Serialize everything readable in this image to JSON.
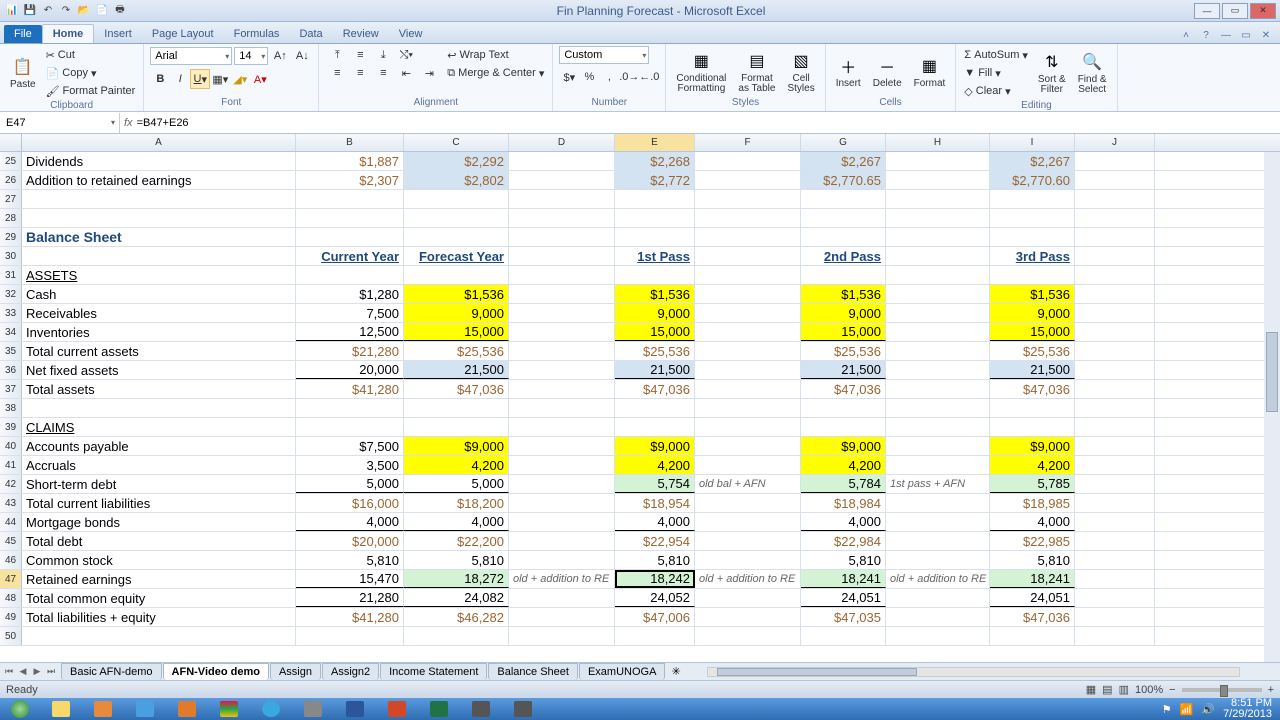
{
  "app": {
    "title": "Fin Planning Forecast - Microsoft Excel"
  },
  "qat": {
    "save": "💾",
    "undo": "↶",
    "redo": "↷",
    "open": "📂",
    "new": "📄"
  },
  "tabs": {
    "file": "File",
    "home": "Home",
    "insert": "Insert",
    "pageLayout": "Page Layout",
    "formulas": "Formulas",
    "data": "Data",
    "review": "Review",
    "view": "View"
  },
  "ribbon": {
    "clipboard": {
      "label": "Clipboard",
      "paste": "Paste",
      "cut": "Cut",
      "copy": "Copy",
      "painter": "Format Painter"
    },
    "font": {
      "label": "Font",
      "name": "Arial",
      "size": "14"
    },
    "alignment": {
      "label": "Alignment",
      "wrap": "Wrap Text",
      "merge": "Merge & Center"
    },
    "number": {
      "label": "Number",
      "format": "Custom"
    },
    "styles": {
      "label": "Styles",
      "cond": "Conditional\nFormatting",
      "table": "Format\nas Table",
      "cell": "Cell\nStyles"
    },
    "cells": {
      "label": "Cells",
      "insert": "Insert",
      "delete": "Delete",
      "format": "Format"
    },
    "editing": {
      "label": "Editing",
      "sum": "AutoSum",
      "fill": "Fill",
      "clear": "Clear",
      "sort": "Sort &\nFilter",
      "find": "Find &\nSelect"
    }
  },
  "namebox": "E47",
  "formula": "=B47+E26",
  "cols": [
    "A",
    "B",
    "C",
    "D",
    "E",
    "F",
    "G",
    "H",
    "I",
    "J"
  ],
  "rows": [
    25,
    26,
    27,
    28,
    29,
    30,
    31,
    32,
    33,
    34,
    35,
    36,
    37,
    38,
    39,
    40,
    41,
    42,
    43,
    44,
    45,
    46,
    47,
    48,
    49,
    50
  ],
  "data": {
    "r25": {
      "A": "Dividends",
      "B": "$1,887",
      "C": "$2,292",
      "E": "$2,268",
      "G": "$2,267",
      "I": "$2,267"
    },
    "r26": {
      "A": "Addition to retained earnings",
      "B": "$2,307",
      "C": "$2,802",
      "E": "$2,772",
      "G": "$2,770.65",
      "I": "$2,770.60"
    },
    "r29": {
      "A": "Balance Sheet"
    },
    "r30": {
      "B": "Current Year",
      "C": "Forecast Year",
      "E": "1st Pass",
      "G": "2nd Pass",
      "I": "3rd Pass"
    },
    "r31": {
      "A": "ASSETS"
    },
    "r32": {
      "A": "Cash",
      "B": "$1,280",
      "C": "$1,536",
      "E": "$1,536",
      "G": "$1,536",
      "I": "$1,536"
    },
    "r33": {
      "A": "Receivables",
      "B": "7,500",
      "C": "9,000",
      "E": "9,000",
      "G": "9,000",
      "I": "9,000"
    },
    "r34": {
      "A": "Inventories",
      "B": "12,500",
      "C": "15,000",
      "E": "15,000",
      "G": "15,000",
      "I": "15,000"
    },
    "r35": {
      "A": "    Total current assets",
      "B": "$21,280",
      "C": "$25,536",
      "E": "$25,536",
      "G": "$25,536",
      "I": "$25,536"
    },
    "r36": {
      "A": "Net fixed assets",
      "B": "20,000",
      "C": "21,500",
      "E": "21,500",
      "G": "21,500",
      "I": "21,500"
    },
    "r37": {
      "A": "Total assets",
      "B": "$41,280",
      "C": "$47,036",
      "E": "$47,036",
      "G": "$47,036",
      "I": "$47,036"
    },
    "r39": {
      "A": "CLAIMS"
    },
    "r40": {
      "A": "Accounts payable",
      "B": "$7,500",
      "C": "$9,000",
      "E": "$9,000",
      "G": "$9,000",
      "I": "$9,000"
    },
    "r41": {
      "A": "Accruals",
      "B": "3,500",
      "C": "4,200",
      "E": "4,200",
      "G": "4,200",
      "I": "4,200"
    },
    "r42": {
      "A": "Short-term debt",
      "B": "5,000",
      "C": "5,000",
      "E": "5,754",
      "F": "old bal + AFN",
      "G": "5,784",
      "H": "1st pass + AFN",
      "I": "5,785"
    },
    "r43": {
      "A": "    Total current liabilities",
      "B": "$16,000",
      "C": "$18,200",
      "E": "$18,954",
      "G": "$18,984",
      "I": "$18,985"
    },
    "r44": {
      "A": "Mortgage bonds",
      "B": "4,000",
      "C": "4,000",
      "E": "4,000",
      "G": "4,000",
      "I": "4,000"
    },
    "r45": {
      "A": "    Total debt",
      "B": "$20,000",
      "C": "$22,200",
      "E": "$22,954",
      "G": "$22,984",
      "I": "$22,985"
    },
    "r46": {
      "A": "Common stock",
      "B": "5,810",
      "C": "5,810",
      "E": "5,810",
      "G": "5,810",
      "I": "5,810"
    },
    "r47": {
      "A": "Retained earnings",
      "B": "15,470",
      "C": "18,272",
      "D": "old + addition to RE",
      "E": "18,242",
      "F": "old + addition to RE",
      "G": "18,241",
      "H": "old + addition to RE",
      "I": "18,241"
    },
    "r48": {
      "A": "    Total common equity",
      "B": "21,280",
      "C": "24,082",
      "E": "24,052",
      "G": "24,051",
      "I": "24,051"
    },
    "r49": {
      "A": "Total liabilities + equity",
      "B": "$41,280",
      "C": "$46,282",
      "E": "$47,006",
      "G": "$47,035",
      "I": "$47,036"
    }
  },
  "sheets": [
    "Basic AFN-demo",
    "AFN-Video demo",
    "Assign",
    "Assign2",
    "Income Statement",
    "Balance Sheet",
    "ExamUNOGA"
  ],
  "activeSheet": 1,
  "status": "Ready",
  "zoom": "100%",
  "clock": {
    "time": "8:51 PM",
    "date": "7/29/2013"
  }
}
